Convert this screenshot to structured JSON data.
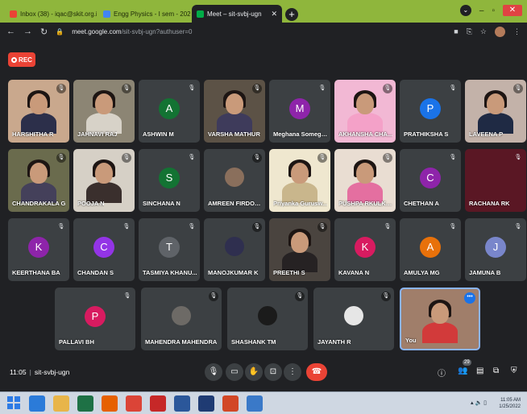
{
  "browser": {
    "tabs": [
      {
        "label": "Inbox (38) - iqac@skit.org.in - Sri",
        "favicon_color": "#ea4335"
      },
      {
        "label": "Engg Physics - I sem - 2021-22 F",
        "favicon_color": "#4285f4"
      },
      {
        "label": "Meet – sit-svbj-ugn",
        "favicon_color": "#00ac47"
      }
    ],
    "url_host": "meet.google.com",
    "url_path": "/sit-svbj-ugn?authuser=0"
  },
  "meet": {
    "rec_label": "REC",
    "meeting_time": "11:05",
    "meeting_code": "sit-svbj-ugn",
    "participants_count": "29",
    "participants": [
      {
        "name": "HARSHITHA R",
        "kind": "video",
        "bg": "#c9a88d",
        "shirt": "#2c2f4a"
      },
      {
        "name": "JAHNAVI RAJ",
        "kind": "video",
        "bg": "#8c8574",
        "shirt": "#d7d2c8"
      },
      {
        "name": "ASHWIN M",
        "kind": "avatar",
        "letter": "A",
        "color": "#137333"
      },
      {
        "name": "VARSHA MATHUR",
        "kind": "video",
        "bg": "#5c5246",
        "shirt": "#3e3b5b"
      },
      {
        "name": "Meghana Somego...",
        "kind": "avatar",
        "letter": "M",
        "color": "#8e24aa"
      },
      {
        "name": "AKHANSHA CHA...",
        "kind": "video",
        "bg": "#f2b8d4",
        "shirt": "#f4a1c8"
      },
      {
        "name": "PRATHIKSHA S",
        "kind": "avatar",
        "letter": "P",
        "color": "#1a73e8"
      },
      {
        "name": "LAVEENA P",
        "kind": "video",
        "bg": "#c3b2a9",
        "shirt": "#1f2a44"
      },
      {
        "name": "CHANDRAKALA G",
        "kind": "video",
        "bg": "#6a6b4d",
        "shirt": "#44405a"
      },
      {
        "name": "POOJA N",
        "kind": "video",
        "bg": "#d6d0c6",
        "shirt": "#3a2f2d"
      },
      {
        "name": "SINCHANA N",
        "kind": "avatar",
        "letter": "S",
        "color": "#137333"
      },
      {
        "name": "AMREEN FIRDOSEA",
        "kind": "photo",
        "color": "#8a6f5c"
      },
      {
        "name": "Priyanka Gurusw...",
        "kind": "video",
        "bg": "#efe7cf",
        "shirt": "#c9b68c"
      },
      {
        "name": "PUSHPA RKULKA...",
        "kind": "video",
        "bg": "#e9ddd2",
        "shirt": "#e46fa0"
      },
      {
        "name": "CHETHAN A",
        "kind": "avatar",
        "letter": "C",
        "color": "#8e24aa"
      },
      {
        "name": "RACHANA RK",
        "kind": "dark",
        "bg": "#5a1724"
      },
      {
        "name": "KEERTHANA BA",
        "kind": "avatar",
        "letter": "K",
        "color": "#8e24aa"
      },
      {
        "name": "CHANDAN S",
        "kind": "avatar",
        "letter": "C",
        "color": "#9334e6"
      },
      {
        "name": "TASMIYA KHANU...",
        "kind": "avatar",
        "letter": "T",
        "color": "#5f6368"
      },
      {
        "name": "MANOJKUMAR K",
        "kind": "photo",
        "color": "#2f2f4f"
      },
      {
        "name": "PREETHI S",
        "kind": "video",
        "bg": "#4a443f",
        "shirt": "#262223"
      },
      {
        "name": "KAVANA N",
        "kind": "avatar",
        "letter": "K",
        "color": "#d81b60"
      },
      {
        "name": "AMULYA MG",
        "kind": "avatar",
        "letter": "A",
        "color": "#e8710a"
      },
      {
        "name": "JAMUNA B",
        "kind": "avatar",
        "letter": "J",
        "color": "#7986cb"
      },
      {
        "name": "PALLAVI BH",
        "kind": "avatar",
        "letter": "P",
        "color": "#d81b60"
      },
      {
        "name": "MAHENDRA MAHENDRA",
        "kind": "photo",
        "color": "#6d6a66"
      },
      {
        "name": "SHASHANK TM",
        "kind": "photo",
        "color": "#1b1b1b"
      },
      {
        "name": "JAYANTH R",
        "kind": "photo",
        "color": "#e6e6e6"
      },
      {
        "name": "You",
        "kind": "self",
        "bg": "#a07e6a",
        "shirt": "#d23a3a"
      }
    ]
  },
  "taskbar": {
    "clock_time": "11:05 AM",
    "clock_date": "1/25/2022",
    "apps": [
      {
        "name": "ie",
        "color": "#2b7bd9"
      },
      {
        "name": "explorer",
        "color": "#e8b54a"
      },
      {
        "name": "excel",
        "color": "#1e7145"
      },
      {
        "name": "firefox",
        "color": "#e66000"
      },
      {
        "name": "chrome",
        "color": "#db4437"
      },
      {
        "name": "pdf",
        "color": "#c62828"
      },
      {
        "name": "word",
        "color": "#2b579a"
      },
      {
        "name": "teams",
        "color": "#1f3b73"
      },
      {
        "name": "powerpoint",
        "color": "#d24726"
      },
      {
        "name": "media",
        "color": "#3a79c8"
      }
    ]
  }
}
